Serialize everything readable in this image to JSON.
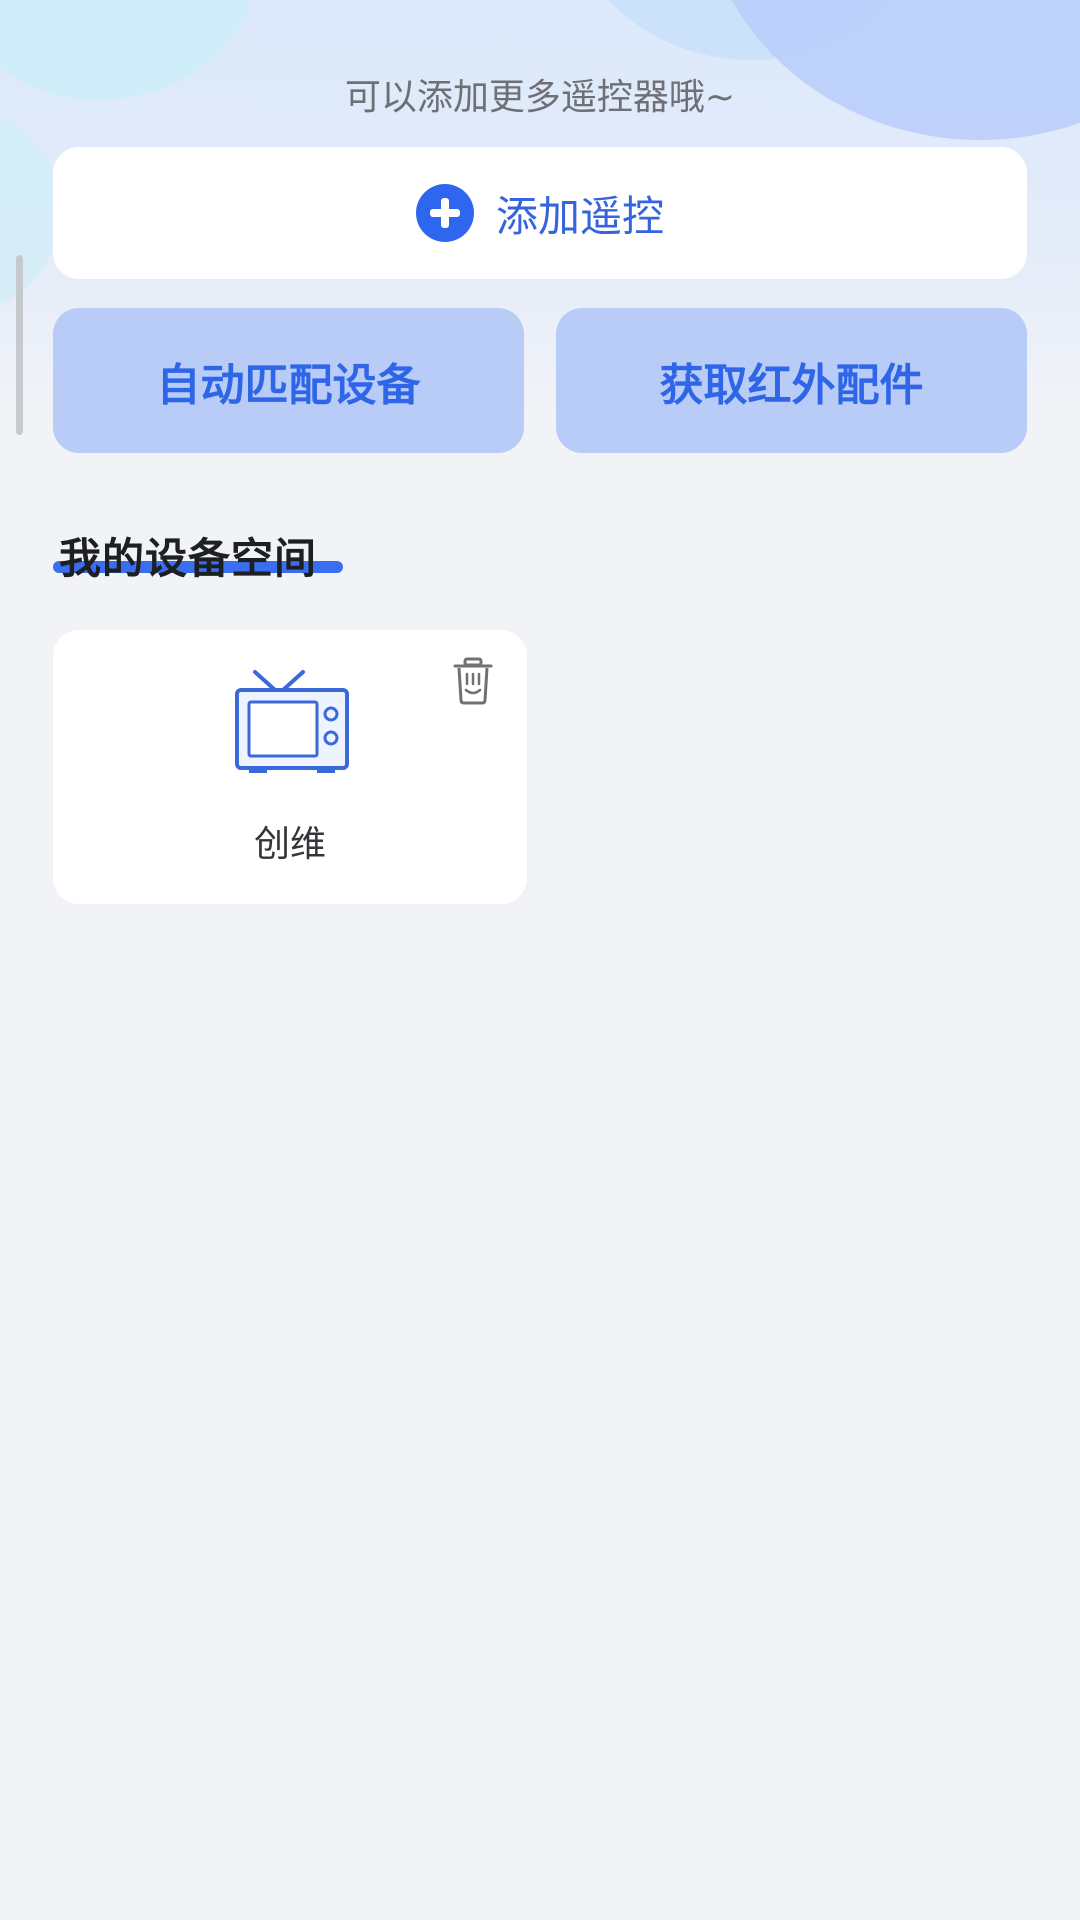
{
  "header": {
    "hint": "可以添加更多遥控器哦~"
  },
  "add_remote": {
    "label": "添加遥控",
    "icon": "plus-circle-icon",
    "accent_color": "#2f66f0"
  },
  "actions": [
    {
      "label": "自动匹配设备"
    },
    {
      "label": "获取红外配件"
    }
  ],
  "section": {
    "title": "我的设备空间"
  },
  "devices": [
    {
      "name": "创维",
      "icon": "tv-icon"
    }
  ],
  "colors": {
    "page_background": "#f1f3f7",
    "button_fill": "#b8ccf7",
    "button_text": "#2f66e8",
    "underline": "#3a6ef0"
  }
}
